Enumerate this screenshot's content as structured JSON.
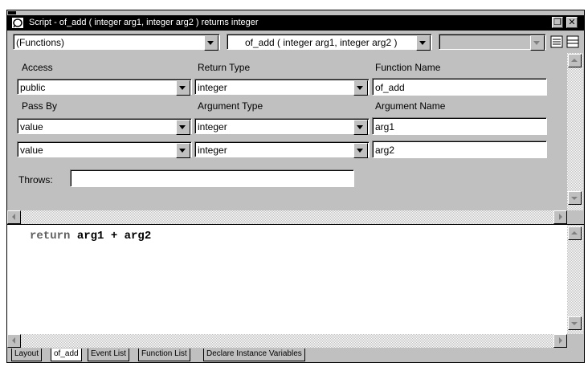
{
  "window": {
    "title": "Script - of_add ( integer arg1, integer arg2 ) returns integer",
    "restore_glyph": "❐",
    "close_glyph": "✕"
  },
  "toolbar": {
    "object_combo": "(Functions)",
    "function_combo": "of_add ( integer arg1, integer arg2 )",
    "third_combo": ""
  },
  "labels": {
    "access": "Access",
    "return_type": "Return Type",
    "function_name": "Function Name",
    "pass_by": "Pass By",
    "argument_type": "Argument Type",
    "argument_name": "Argument Name",
    "throws": "Throws:"
  },
  "signature": {
    "access": "public",
    "return_type": "integer",
    "function_name": "of_add"
  },
  "arguments": [
    {
      "pass_by": "value",
      "type": "integer",
      "name": "arg1"
    },
    {
      "pass_by": "value",
      "type": "integer",
      "name": "arg2"
    }
  ],
  "throws_value": "",
  "code": {
    "keyword": "return",
    "expression": " arg1 + arg2"
  },
  "tabs": [
    "Layout",
    "of_add",
    "Event List",
    "Function List",
    "Declare Instance Variables"
  ],
  "active_tab": "of_add"
}
